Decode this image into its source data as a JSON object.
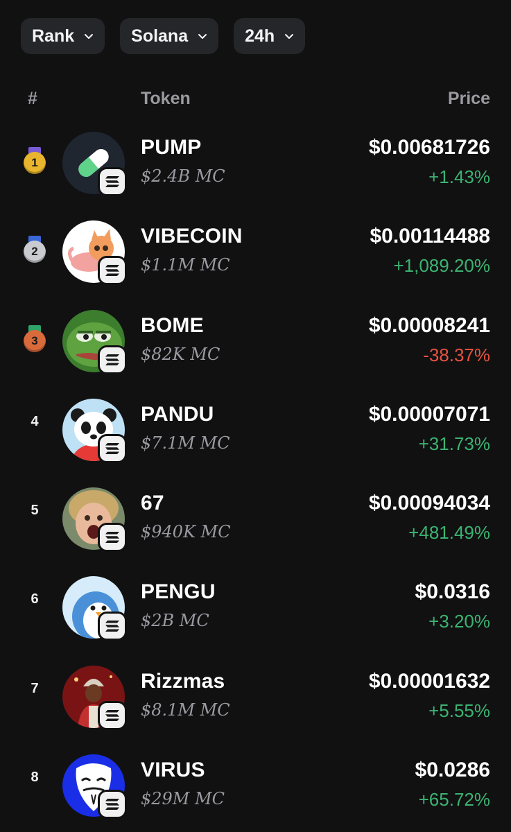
{
  "filters": [
    {
      "label": "Rank"
    },
    {
      "label": "Solana"
    },
    {
      "label": "24h"
    }
  ],
  "table": {
    "headers": {
      "rank": "#",
      "token": "Token",
      "price": "Price"
    },
    "rows": [
      {
        "rank": "1",
        "name": "PUMP",
        "market_cap": "$2.4B MC",
        "price": "$0.00681726",
        "change": "+1.43%",
        "direction": "up",
        "icon": "pill-icon",
        "medal": "gold"
      },
      {
        "rank": "2",
        "name": "VIBECOIN",
        "market_cap": "$1.1M MC",
        "price": "$0.00114488",
        "change": "+1,089.20%",
        "direction": "up",
        "icon": "cat-avatar",
        "medal": "silver"
      },
      {
        "rank": "3",
        "name": "BOME",
        "market_cap": "$82K MC",
        "price": "$0.00008241",
        "change": "-38.37%",
        "direction": "down",
        "icon": "pepe-frog-avatar",
        "medal": "bronze"
      },
      {
        "rank": "4",
        "name": "PANDU",
        "market_cap": "$7.1M MC",
        "price": "$0.00007071",
        "change": "+31.73%",
        "direction": "up",
        "icon": "panda-avatar",
        "medal": null
      },
      {
        "rank": "5",
        "name": "67",
        "market_cap": "$940K MC",
        "price": "$0.00094034",
        "change": "+481.49%",
        "direction": "up",
        "icon": "kid-photo-avatar",
        "medal": null
      },
      {
        "rank": "6",
        "name": "PENGU",
        "market_cap": "$2B MC",
        "price": "$0.0316",
        "change": "+3.20%",
        "direction": "up",
        "icon": "penguin-avatar",
        "medal": null
      },
      {
        "rank": "7",
        "name": "Rizzmas",
        "market_cap": "$8.1M MC",
        "price": "$0.00001632",
        "change": "+5.55%",
        "direction": "up",
        "icon": "rizzmas-avatar",
        "medal": null
      },
      {
        "rank": "8",
        "name": "VIRUS",
        "market_cap": "$29M MC",
        "price": "$0.0286",
        "change": "+65.72%",
        "direction": "up",
        "icon": "anonymous-mask-avatar",
        "medal": null
      }
    ]
  },
  "colors": {
    "background": "#111112",
    "chip": "#25262a",
    "positive": "#3cb371",
    "negative": "#e8533f",
    "muted": "#9a9aa0",
    "gold": "#e9b52c",
    "silver": "#c9cbd0",
    "bronze": "#d86a3c"
  },
  "chain_badge_icon": "solana-icon"
}
